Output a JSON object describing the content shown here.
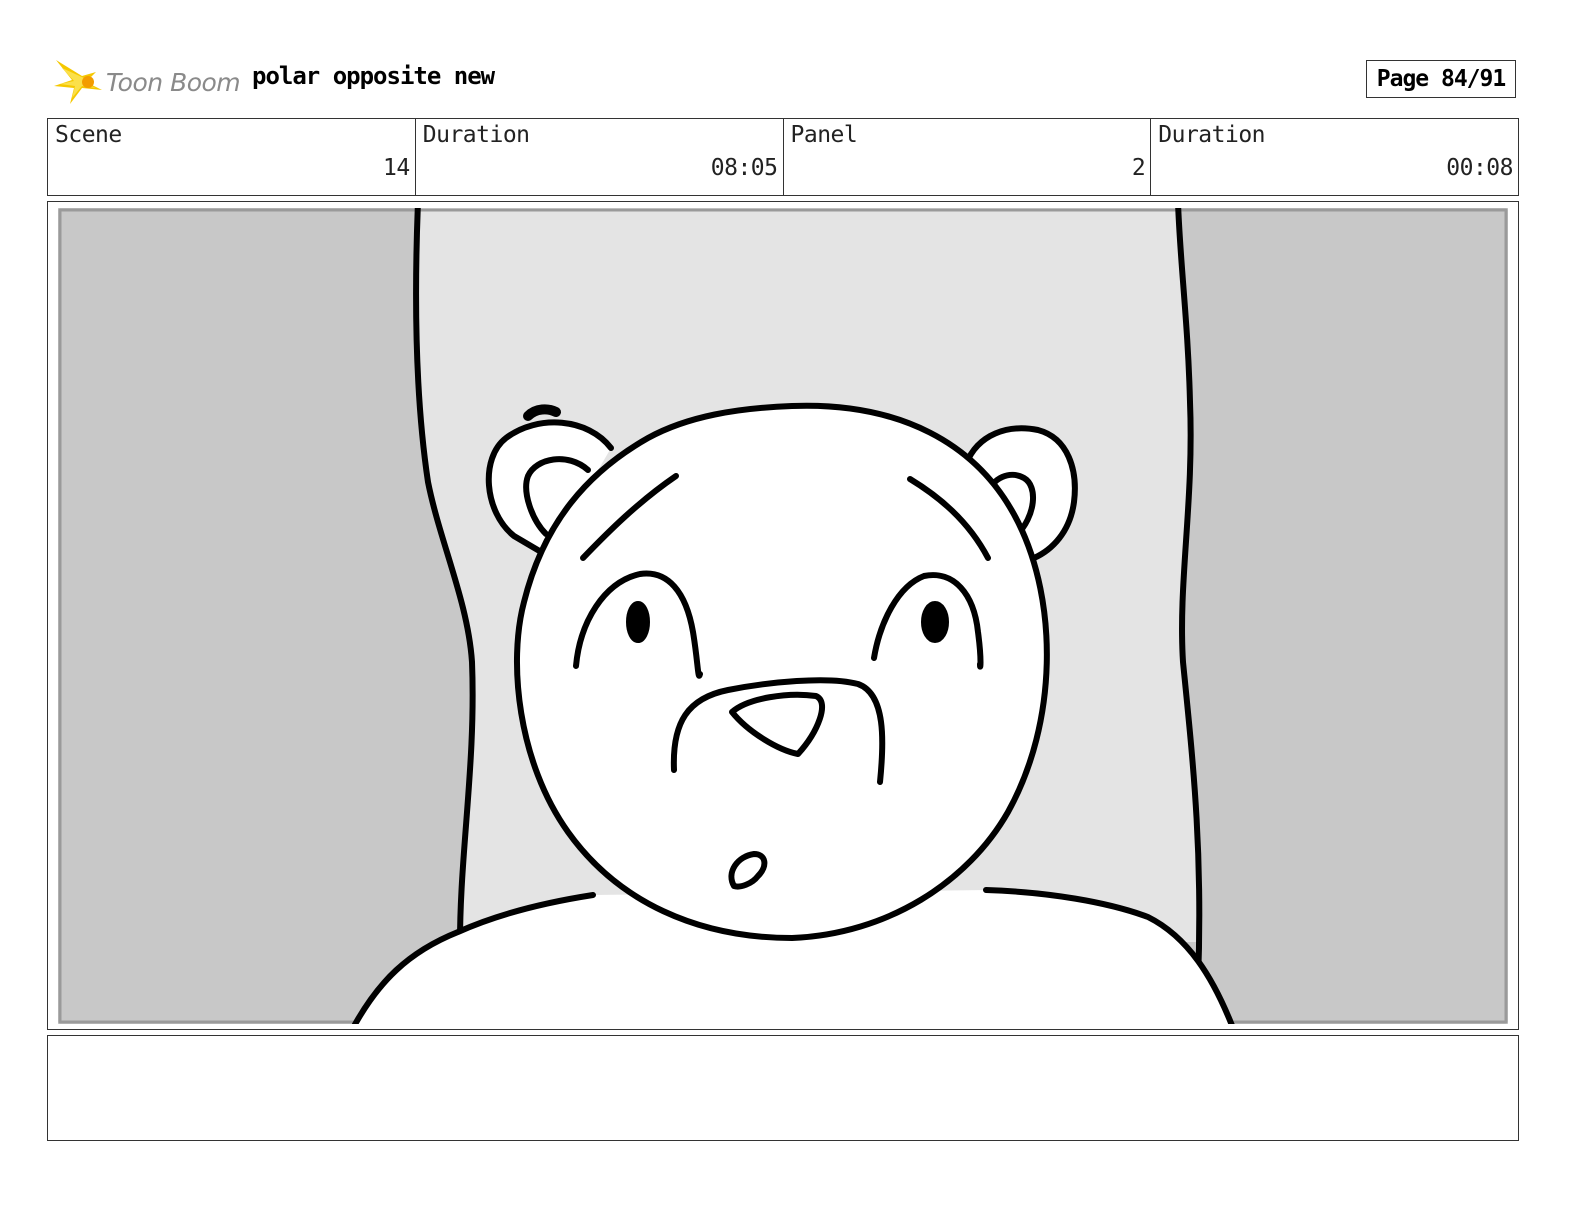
{
  "header": {
    "logo_text": "Toon Boom",
    "logo_icon": "starburst-logo-icon",
    "project_title": "polar opposite new",
    "page_label": "Page 84/91"
  },
  "info": {
    "scene_label": "Scene",
    "scene_value": "14",
    "scene_duration_label": "Duration",
    "scene_duration_value": "08:05",
    "panel_label": "Panel",
    "panel_value": "2",
    "panel_duration_label": "Duration",
    "panel_duration_value": "00:08"
  },
  "colors": {
    "side_gray": "#c8c8c8",
    "back_gray": "#e4e4e4",
    "line": "#000000",
    "logo_yellow": "#f5c800"
  }
}
